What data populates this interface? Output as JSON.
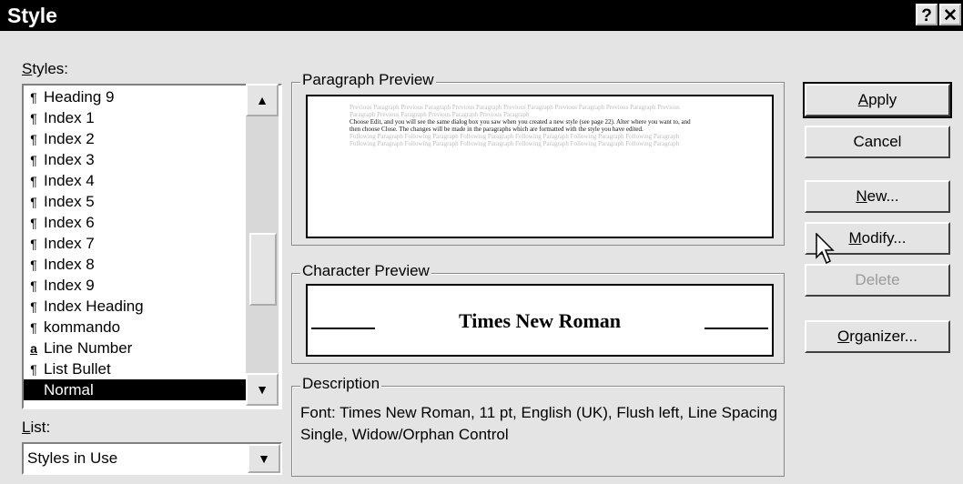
{
  "window": {
    "title": "Style",
    "help_label": "?",
    "close_label": "✕"
  },
  "styles_panel": {
    "label_prefix": "",
    "label_key": "S",
    "label_rest": "tyles:",
    "items": [
      {
        "glyph": "¶",
        "label": "Heading 9"
      },
      {
        "glyph": "¶",
        "label": "Index 1"
      },
      {
        "glyph": "¶",
        "label": "Index 2"
      },
      {
        "glyph": "¶",
        "label": "Index 3"
      },
      {
        "glyph": "¶",
        "label": "Index 4"
      },
      {
        "glyph": "¶",
        "label": "Index 5"
      },
      {
        "glyph": "¶",
        "label": "Index 6"
      },
      {
        "glyph": "¶",
        "label": "Index 7"
      },
      {
        "glyph": "¶",
        "label": "Index 8"
      },
      {
        "glyph": "¶",
        "label": "Index 9"
      },
      {
        "glyph": "¶",
        "label": "Index Heading"
      },
      {
        "glyph": "¶",
        "label": "kommando"
      },
      {
        "glyph": "a",
        "label": "Line Number"
      },
      {
        "glyph": "¶",
        "label": "List Bullet"
      },
      {
        "glyph": "",
        "label": "Normal"
      }
    ],
    "selected": "Normal"
  },
  "list_filter": {
    "label_key": "L",
    "label_rest": "ist:",
    "value": "Styles in Use"
  },
  "paragraph_preview": {
    "title": "Paragraph Preview",
    "previous": "Previous Paragraph Previous Paragraph Previous Paragraph Previous Paragraph Previous Paragraph Previous Paragraph Previous Paragraph Previous Paragraph Previous Paragraph Previous Paragraph",
    "current": "Choose Edit, and you will see the same dialog box you saw when you created a new style (see page 22). Alter where you want to, and then choose Close. The changes will be made in the paragraphs which are formatted with the style you have edited.",
    "following": "Following Paragraph Following Paragraph Following Paragraph Following Paragraph Following Paragraph Following Paragraph Following Paragraph Following Paragraph Following Paragraph Following Paragraph Following Paragraph Following Paragraph"
  },
  "character_preview": {
    "title": "Character Preview",
    "text": "Times New Roman"
  },
  "description": {
    "title": "Description",
    "text": "Font: Times New Roman, 11 pt, English (UK), Flush left, Line Spacing Single, Widow/Orphan Control"
  },
  "buttons": {
    "apply": {
      "key": "A",
      "rest": "pply"
    },
    "cancel": "Cancel",
    "new": {
      "key": "N",
      "rest": "ew..."
    },
    "modify": {
      "key": "M",
      "rest": "odify..."
    },
    "delete": "Delete",
    "organizer": {
      "key": "O",
      "rest": "rganizer..."
    }
  }
}
